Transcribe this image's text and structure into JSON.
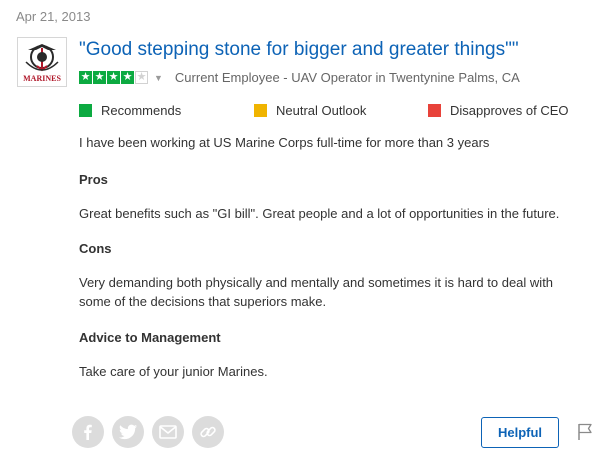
{
  "review": {
    "date": "Apr 21, 2013",
    "title": "\"Good stepping stone for bigger and greater things\"\"",
    "company_logo_text": "MARINES",
    "rating": {
      "stars_filled": 4,
      "stars_total": 5
    },
    "job_title": "Current Employee - UAV Operator in Twentynine Palms, CA",
    "indicators": [
      {
        "label": "Recommends",
        "color": "#0caa41"
      },
      {
        "label": "Neutral Outlook",
        "color": "#f0b400"
      },
      {
        "label": "Disapproves of CEO",
        "color": "#e8423a"
      }
    ],
    "employment": "I have been working at US Marine Corps full-time for more than 3 years",
    "pros_heading": "Pros",
    "pros_text": "Great benefits such as \"GI bill\". Great people and a lot of opportunities in the future.",
    "cons_heading": "Cons",
    "cons_line1": "Very demanding both physically and mentally and sometimes it is hard to deal with",
    "cons_line2": "some of the decisions that superiors make.",
    "advice_heading": "Advice to Management",
    "advice_text": "Take care of your junior Marines."
  },
  "actions": {
    "share_icons": [
      "facebook-icon",
      "twitter-icon",
      "email-icon",
      "link-icon"
    ],
    "helpful_label": "Helpful",
    "flag_icon": "flag-icon"
  }
}
